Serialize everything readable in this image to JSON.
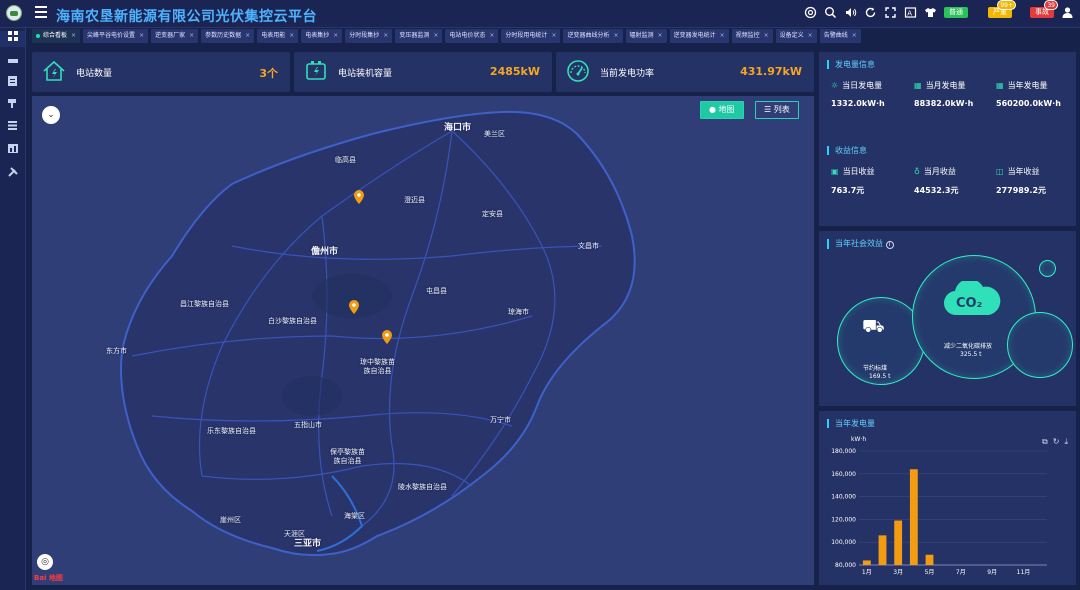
{
  "app": {
    "title": "海南农垦新能源有限公司光伏集控云平台"
  },
  "header": {
    "badges": [
      {
        "label": "普通",
        "color": "#2bc25a",
        "count": ""
      },
      {
        "label": "严重",
        "color": "#f2b705",
        "count": "99+"
      },
      {
        "label": "事故",
        "color": "#e33b3b",
        "count": "39"
      }
    ],
    "icons": [
      "help-icon",
      "search-icon",
      "sound-icon",
      "refresh-icon",
      "expand-icon",
      "font-icon",
      "theme-icon"
    ]
  },
  "sidebar": {
    "icons": [
      "dashboard-icon",
      "device-icon",
      "document-icon",
      "camera-icon",
      "list-icon",
      "chart-icon",
      "tools-icon"
    ]
  },
  "tabs": [
    {
      "label": "综合看板",
      "active": true
    },
    {
      "label": "尖峰平谷电价设置"
    },
    {
      "label": "逆变器厂家"
    },
    {
      "label": "参数历史数据"
    },
    {
      "label": "电表用能"
    },
    {
      "label": "电表集抄"
    },
    {
      "label": "分时段集抄"
    },
    {
      "label": "变压器监测"
    },
    {
      "label": "电站电价状态"
    },
    {
      "label": "分时段用电统计"
    },
    {
      "label": "逆变器曲线分析"
    },
    {
      "label": "辐射监测"
    },
    {
      "label": "逆变器发电统计"
    },
    {
      "label": "视频监控"
    },
    {
      "label": "设备定义"
    },
    {
      "label": "告警曲线"
    }
  ],
  "stats": [
    {
      "label": "电站数量",
      "value": "3个"
    },
    {
      "label": "电站装机容量",
      "value": "2485kW"
    },
    {
      "label": "当前发电功率",
      "value": "431.97kW"
    }
  ],
  "map": {
    "btn_map": "地图",
    "btn_list": "列表",
    "attribution": "Bai 地图",
    "labels": [
      {
        "text": "海口市",
        "big": true
      },
      {
        "text": "美兰区"
      },
      {
        "text": "临高县"
      },
      {
        "text": "澄迈县"
      },
      {
        "text": "定安县"
      },
      {
        "text": "文昌市"
      },
      {
        "text": "儋州市",
        "big": true
      },
      {
        "text": "屯昌县"
      },
      {
        "text": "琼海市"
      },
      {
        "text": "昌江黎族自治县"
      },
      {
        "text": "白沙黎族自治县"
      },
      {
        "text": "琼中黎族苗\n族自治县"
      },
      {
        "text": "东方市"
      },
      {
        "text": "万宁市"
      },
      {
        "text": "五指山市"
      },
      {
        "text": "乐东黎族自治县"
      },
      {
        "text": "保亭黎族苗\n族自治县"
      },
      {
        "text": "陵水黎族自治县"
      },
      {
        "text": "海棠区"
      },
      {
        "text": "崖州区"
      },
      {
        "text": "天涯区"
      },
      {
        "text": "三亚市",
        "big": true
      }
    ]
  },
  "generation": {
    "title": "发电量信息",
    "items": [
      {
        "label": "当日发电量",
        "value": "1332.0kW·h",
        "icon": "sun-icon"
      },
      {
        "label": "当月发电量",
        "value": "88382.0kW·h",
        "icon": "calendar-icon"
      },
      {
        "label": "当年发电量",
        "value": "560200.0kW·h",
        "icon": "calendar-icon"
      }
    ]
  },
  "revenue": {
    "title": "收益信息",
    "items": [
      {
        "label": "当日收益",
        "value": "763.7元",
        "icon": "wallet-icon"
      },
      {
        "label": "当月收益",
        "value": "44532.3元",
        "icon": "moneybag-icon"
      },
      {
        "label": "当年收益",
        "value": "277989.2元",
        "icon": "coins-icon"
      }
    ]
  },
  "social": {
    "title": "当年社会效益",
    "coal_label": "节约标煤",
    "coal_value": "169.5 t",
    "co2_label": "减少二氧化碳排放",
    "co2_value": "325.5 t",
    "co2_icon_text": "CO₂"
  },
  "chart_data": {
    "type": "bar",
    "title": "当年发电量",
    "ylabel": "kW·h",
    "ylim": [
      80000,
      180000
    ],
    "yticks": [
      "80,000",
      "100,000",
      "120,000",
      "140,000",
      "160,000",
      "180,000"
    ],
    "categories": [
      "1月",
      "2月",
      "3月",
      "4月",
      "5月",
      "6月",
      "7月",
      "8月",
      "9月",
      "10月",
      "11月",
      "12月"
    ],
    "xtick_labels": [
      "1月",
      "3月",
      "5月",
      "7月",
      "9月",
      "11月"
    ],
    "values": [
      84000,
      106000,
      119000,
      164000,
      89000,
      0,
      0,
      0,
      0,
      0,
      0,
      0
    ],
    "bar_color": "#f39c12",
    "toolbox_icons": [
      "zoom-icon",
      "restore-icon",
      "download-icon"
    ]
  }
}
